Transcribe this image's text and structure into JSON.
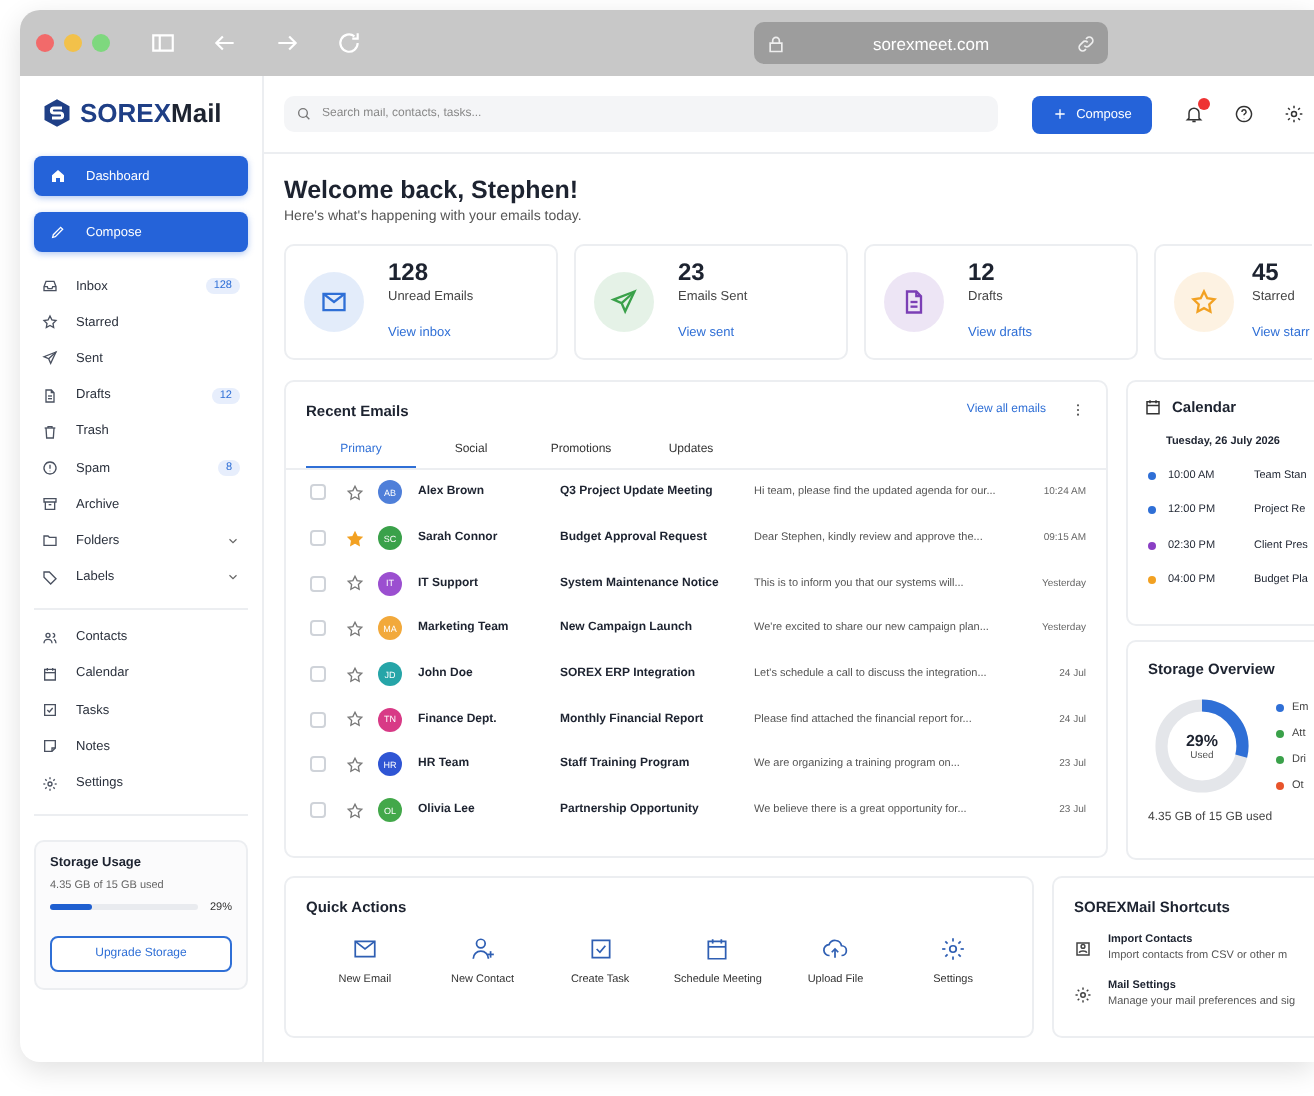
{
  "browser": {
    "url": "sorexmeet.com"
  },
  "brand": {
    "name_prefix": "SOREX",
    "name_suffix": "Mail"
  },
  "sidebar": {
    "items": [
      {
        "label": "Dashboard",
        "kind": "link",
        "selected": true
      },
      {
        "label": "Compose",
        "kind": "action"
      },
      {
        "label": "Inbox",
        "kind": "link",
        "badge": "128",
        "selected": false
      },
      {
        "label": "Starred",
        "kind": "link",
        "selected": false
      },
      {
        "label": "Sent",
        "kind": "link",
        "selected": false
      },
      {
        "label": "Drafts",
        "kind": "link",
        "badge": "12",
        "selected": false
      },
      {
        "label": "Trash",
        "kind": "link",
        "selected": false
      },
      {
        "label": "Spam",
        "kind": "link",
        "badge": "8",
        "selected": false
      },
      {
        "label": "Archive",
        "kind": "link",
        "selected": false
      },
      {
        "label": "Folders",
        "kind": "group",
        "selected": false
      },
      {
        "label": "Labels",
        "kind": "group",
        "selected": false
      }
    ],
    "secondary_items": [
      {
        "label": "Contacts",
        "selected": false
      },
      {
        "label": "Calendar",
        "selected": false
      },
      {
        "label": "Tasks",
        "selected": false
      },
      {
        "label": "Notes",
        "selected": false
      },
      {
        "label": "Settings",
        "selected": false
      }
    ],
    "storage": {
      "title": "Storage Usage",
      "used": "4.35 GB of 15 GB used",
      "level": 0.29,
      "percent": "29%",
      "button": "Upgrade Storage"
    }
  },
  "topbar": {
    "search": {
      "placeholder": "Search mail, contacts, tasks..."
    },
    "compose_button": "Compose",
    "has_notifications": true
  },
  "welcome": {
    "title": "Welcome back, Stephen!",
    "subtitle": "Here's what's happening with your emails today."
  },
  "stats": [
    {
      "value": "128",
      "label": "Unread Emails",
      "link": "View inbox",
      "color": "#2f6fd6"
    },
    {
      "value": "23",
      "label": "Emails Sent",
      "link": "View sent",
      "color": "#3aa14a"
    },
    {
      "value": "12",
      "label": "Drafts",
      "link": "View drafts",
      "color": "#7b3fb5"
    },
    {
      "value": "45",
      "label": "Starred",
      "link": "View starr",
      "color": "#f2a122"
    }
  ],
  "recent_emails": {
    "title": "Recent Emails",
    "view_all": "View all emails",
    "tabs": [
      {
        "label": "Primary",
        "selected": true
      },
      {
        "label": "Social",
        "selected": false
      },
      {
        "label": "Promotions",
        "selected": false
      },
      {
        "label": "Updates",
        "selected": false
      }
    ],
    "rows": [
      {
        "initials": "AB",
        "color": "#4f7fd9",
        "sender": "Alex Brown",
        "subject": "Q3 Project Update Meeting",
        "preview": "Hi team, please find the updated agenda for our...",
        "time": "10:24 AM",
        "starred": false,
        "checked": false
      },
      {
        "initials": "SC",
        "color": "#3aa14a",
        "sender": "Sarah Connor",
        "subject": "Budget Approval Request",
        "preview": "Dear Stephen, kindly review and approve the...",
        "time": "09:15 AM",
        "starred": true,
        "checked": false
      },
      {
        "initials": "IT",
        "color": "#9b4fd0",
        "sender": "IT Support",
        "subject": "System Maintenance Notice",
        "preview": "This is to inform you that our systems will...",
        "time": "Yesterday",
        "starred": false,
        "checked": false
      },
      {
        "initials": "MA",
        "color": "#f2a93b",
        "sender": "Marketing Team",
        "subject": "New Campaign Launch",
        "preview": "We're excited to share our new campaign plan...",
        "time": "Yesterday",
        "starred": false,
        "checked": false
      },
      {
        "initials": "JD",
        "color": "#26a5a8",
        "sender": "John Doe",
        "subject": "SOREX ERP Integration",
        "preview": "Let's schedule a call to discuss the integration...",
        "time": "24 Jul",
        "starred": false,
        "checked": false
      },
      {
        "initials": "TN",
        "color": "#d83a86",
        "sender": "Finance Dept.",
        "subject": "Monthly Financial Report",
        "preview": "Please find attached the financial report for...",
        "time": "24 Jul",
        "starred": false,
        "checked": false
      },
      {
        "initials": "HR",
        "color": "#2f55d4",
        "sender": "HR Team",
        "subject": "Staff Training Program",
        "preview": "We are organizing a training program on...",
        "time": "23 Jul",
        "starred": false,
        "checked": false
      },
      {
        "initials": "OL",
        "color": "#43a84a",
        "sender": "Olivia Lee",
        "subject": "Partnership Opportunity",
        "preview": "We believe there is a great opportunity for...",
        "time": "23 Jul",
        "starred": false,
        "checked": false
      }
    ]
  },
  "calendar": {
    "title": "Calendar",
    "date": "Tuesday, 26 July 2026",
    "events": [
      {
        "time": "10:00 AM",
        "title": "Team Stan",
        "color": "#2f6fd6"
      },
      {
        "time": "12:00 PM",
        "title": "Project Re",
        "color": "#2f6fd6"
      },
      {
        "time": "02:30 PM",
        "title": "Client Pres",
        "color": "#8a3fc4"
      },
      {
        "time": "04:00 PM",
        "title": "Budget Pla",
        "color": "#f2a122"
      }
    ]
  },
  "storage_overview": {
    "title": "Storage Overview",
    "level": 0.29,
    "percent": "29%",
    "caption": "Used",
    "used": "4.35 GB of 15 GB used",
    "legend": [
      {
        "label": "Em",
        "color": "#2f6fd6"
      },
      {
        "label": "Att",
        "color": "#3aa14a"
      },
      {
        "label": "Dri",
        "color": "#3aa14a"
      },
      {
        "label": "Ot",
        "color": "#e8542b"
      }
    ]
  },
  "quick_actions": {
    "title": "Quick Actions",
    "items": [
      {
        "label": "New Email"
      },
      {
        "label": "New Contact"
      },
      {
        "label": "Create Task"
      },
      {
        "label": "Schedule Meeting"
      },
      {
        "label": "Upload File"
      },
      {
        "label": "Settings"
      }
    ]
  },
  "shortcuts": {
    "title": "SOREXMail Shortcuts",
    "items": [
      {
        "title": "Import Contacts",
        "description": "Import contacts from CSV or other m"
      },
      {
        "title": "Mail Settings",
        "description": "Manage your mail preferences and sig"
      }
    ]
  }
}
